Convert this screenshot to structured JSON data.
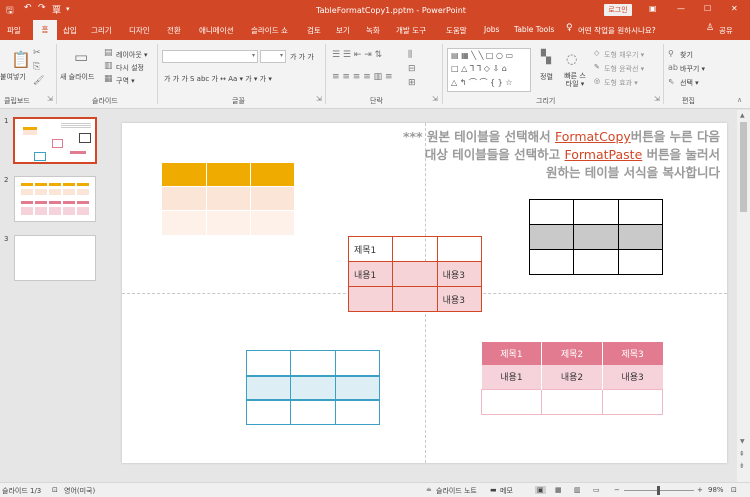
{
  "window": {
    "title": "TableFormatCopy1.pptm  -  PowerPoint",
    "login_label": "로그인"
  },
  "quick_access": {
    "save_icon": "save-icon",
    "undo_icon": "undo-icon",
    "redo_icon": "redo-icon",
    "custom_label": "覃"
  },
  "tabs": [
    {
      "label": "파일"
    },
    {
      "label": "홈"
    },
    {
      "label": "삽입"
    },
    {
      "label": "그리기"
    },
    {
      "label": "디자인"
    },
    {
      "label": "전환"
    },
    {
      "label": "애니메이션"
    },
    {
      "label": "슬라이드 쇼"
    },
    {
      "label": "검토"
    },
    {
      "label": "보기"
    },
    {
      "label": "녹화"
    },
    {
      "label": "개발 도구"
    },
    {
      "label": "도움말"
    },
    {
      "label": "Jobs"
    },
    {
      "label": "Table Tools"
    }
  ],
  "tellme": "어떤 작업을 원하시나요?",
  "share": "공유",
  "ribbon": {
    "paste": "붙여넣기",
    "new_slide": "새 슬라이드",
    "layout": "레이아웃 ▾",
    "reset": "다시 설정",
    "section": "구역 ▾",
    "arrange": "정렬",
    "quick_styles": "빠른 스타일 ▾",
    "shape_fill": "도형 채우기 ▾",
    "shape_outline": "도형 윤곽선 ▾",
    "shape_effects": "도형 효과 ▾",
    "find": "찾기",
    "replace": "바꾸기 ▾",
    "select": "선택 ▾",
    "font_row2": "가  가  가  S  abc  가  ↔  Aa ▾  가 ▾  가 ▾",
    "font_row1": "가  가  가",
    "groups": {
      "clipboard": "클립보드",
      "slides": "슬라이드",
      "font": "글꼴",
      "paragraph": "단락",
      "drawing": "그리기",
      "editing": "편집"
    }
  },
  "thumbnails": [
    {
      "num": "1"
    },
    {
      "num": "2"
    },
    {
      "num": "3"
    }
  ],
  "slide": {
    "note_line1_pre": "*** 원본 테이블을 선택해서 ",
    "note_line1_link": "FormatCopy",
    "note_line1_post": "버튼을 누른 다음",
    "note_line2_pre": "대상 테이블들을 선택하고 ",
    "note_line2_link": "FormatPaste",
    "note_line2_post": " 버튼을 눌러서",
    "note_line3": "원하는 테이블 서식을 복사합니다",
    "center_table": {
      "r1": [
        "제목1",
        "",
        ""
      ],
      "r2": [
        "내용1",
        "",
        "내용3"
      ],
      "r3": [
        "",
        "",
        "내용3"
      ]
    },
    "pink_table": {
      "header": [
        "제목1",
        "제목2",
        "제목3"
      ],
      "row1": [
        "내용1",
        "내용2",
        "내용3"
      ]
    }
  },
  "status": {
    "slide_info": "슬라이드 1/3",
    "lang": "영어(미국)",
    "notes": "슬라이드 노트",
    "comments": "메모",
    "zoom": "98%"
  },
  "colors": {
    "accent": "#d24726",
    "orange": "#f0ab00",
    "blue": "#3c9fc4",
    "pink": "#e27b8f"
  }
}
